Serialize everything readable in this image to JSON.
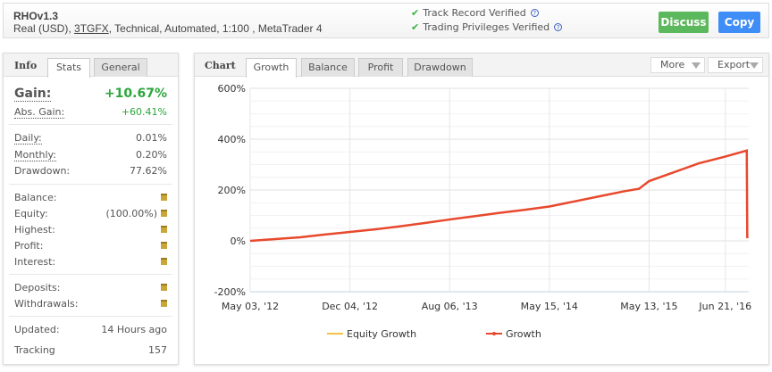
{
  "header": {
    "title": "RHOv1.3",
    "sub_pre": "Real (USD), ",
    "sub_link": "3TGFX",
    "sub_post": ", Technical, Automated, 1:100 , MetaTrader 4",
    "verified": [
      "Track Record Verified",
      "Trading Privileges Verified"
    ],
    "discuss": "Discuss",
    "copy": "Copy",
    "colors": {
      "discuss": "#5cb85c",
      "copy": "#3f8df6"
    }
  },
  "info": {
    "heading": "Info",
    "tabs": [
      "Stats",
      "General"
    ],
    "gain_label": "Gain:",
    "gain": "+10.67%",
    "abs_label": "Abs. Gain:",
    "abs": "+60.41%",
    "daily_label": "Daily:",
    "daily": "0.01%",
    "monthly_label": "Monthly:",
    "monthly": "0.20%",
    "dd_label": "Drawdown:",
    "dd": "77.62%",
    "balance": "Balance:",
    "equity": "Equity:",
    "equity_pct": "(100.00%)",
    "highest": "Highest:",
    "profit": "Profit:",
    "interest": "Interest:",
    "deposits": "Deposits:",
    "withdrawals": "Withdrawals:",
    "updated_label": "Updated:",
    "updated": "14 Hours ago",
    "tracking_label": "Tracking",
    "tracking": "157"
  },
  "chartpanel": {
    "heading": "Chart",
    "tabs": [
      "Growth",
      "Balance",
      "Profit",
      "Drawdown"
    ],
    "more": "More",
    "export": "Export"
  },
  "chart_data": {
    "type": "line",
    "title": "",
    "xlabel": "",
    "ylabel": "",
    "ylim": [
      -200,
      600
    ],
    "yticks": [
      -200,
      0,
      200,
      400,
      600
    ],
    "ytick_labels": [
      "-200%",
      "0%",
      "200%",
      "400%",
      "600%"
    ],
    "xlim": [
      0,
      100
    ],
    "xticks": [
      0,
      20,
      40,
      60,
      80,
      95.3
    ],
    "xtick_labels": [
      "May 03, '12",
      "Dec 04, '12",
      "Aug 06, '13",
      "May 15, '14",
      "May 13, '15",
      "Jun 21, '16"
    ],
    "grid": true,
    "legend": "bottom",
    "series": [
      {
        "name": "Equity Growth",
        "color": "#f5c342",
        "x": [],
        "y": []
      },
      {
        "name": "Growth",
        "color": "#e8482c",
        "x": [
          0,
          5,
          10,
          15,
          20,
          25,
          30,
          35,
          40,
          45,
          50,
          55,
          60,
          65,
          70,
          75,
          78,
          80,
          85,
          90,
          95,
          99.6,
          99.7
        ],
        "y": [
          0,
          7,
          14,
          25,
          35,
          45,
          57,
          70,
          84,
          97,
          110,
          122,
          135,
          155,
          175,
          195,
          205,
          235,
          270,
          305,
          330,
          355,
          10
        ]
      }
    ]
  }
}
